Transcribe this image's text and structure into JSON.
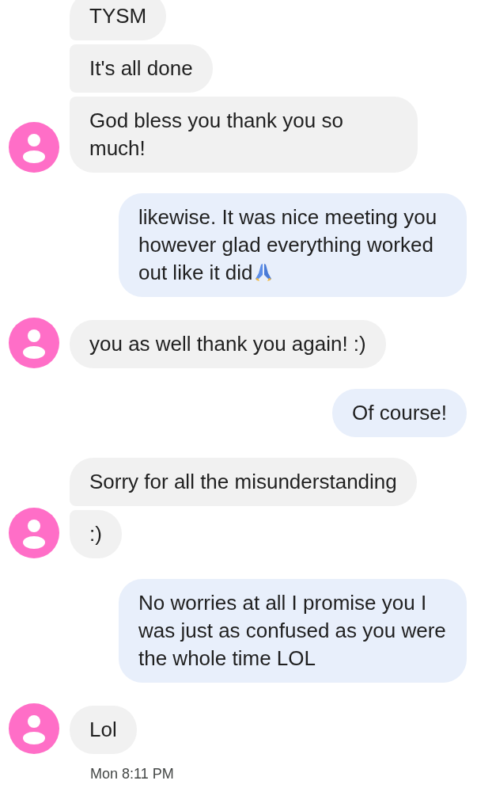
{
  "conversation": [
    {
      "kind": "received",
      "messages": [
        {
          "text": "TYSM"
        },
        {
          "text": "It's all done"
        },
        {
          "text": "God bless you thank you so much!"
        }
      ]
    },
    {
      "kind": "sent",
      "messages": [
        {
          "text": "likewise. It was nice meeting you however glad everything worked out like it did",
          "kind": "praying-hands-ending"
        }
      ]
    },
    {
      "kind": "received",
      "messages": [
        {
          "text": "you as well thank you again! :)"
        }
      ]
    },
    {
      "kind": "sent",
      "messages": [
        {
          "text": "Of course!"
        }
      ]
    },
    {
      "kind": "received",
      "messages": [
        {
          "text": "Sorry for all the misunderstanding"
        },
        {
          "text": ":)"
        }
      ]
    },
    {
      "kind": "sent",
      "messages": [
        {
          "text": "No worries at all I promise you I was just as confused as you were the whole time LOL"
        }
      ]
    },
    {
      "kind": "received",
      "messages": [
        {
          "text": "Lol"
        }
      ],
      "timestamp": "Mon 8:11 PM"
    }
  ]
}
